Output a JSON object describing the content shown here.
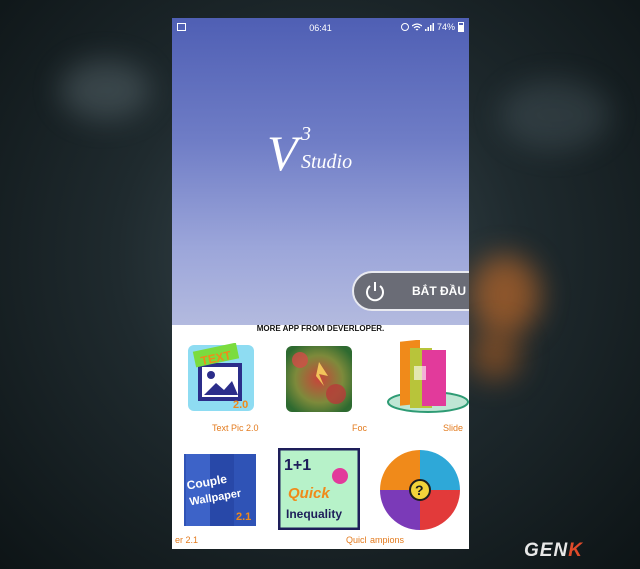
{
  "status_bar": {
    "time": "06:41",
    "battery": "74%"
  },
  "logo": {
    "main": "V",
    "sup": "3",
    "sub": "Studio"
  },
  "start_button": {
    "label": "BẮT ĐẦU"
  },
  "more_apps": {
    "title": "MORE APP FROM DEVERLOPER.",
    "items": [
      {
        "label": "Text Pic 2.0",
        "badge": "TEXT",
        "version": "2.0"
      },
      {
        "label": "Foc"
      },
      {
        "label": "Slide"
      },
      {
        "label": "er 2.1",
        "tile_text_1": "Couple",
        "tile_text_2": "Wallpaper",
        "version": "2.1"
      },
      {
        "label": "Quicl",
        "tile_text_1": "1+1",
        "tile_text_2": "Quick",
        "tile_text_3": "Inequality"
      },
      {
        "label": "ampions"
      }
    ]
  },
  "watermark": {
    "text_main": "GEN",
    "text_accent": "K"
  },
  "colors": {
    "accent_orange": "#e37b1e",
    "hero_top": "#4f5fb4",
    "hero_bottom": "#b3badf"
  }
}
